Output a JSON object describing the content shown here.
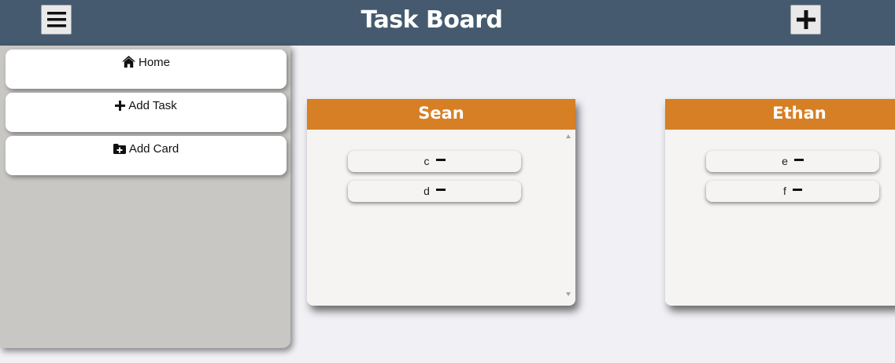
{
  "header": {
    "title": "Task Board",
    "menu_icon": "hamburger-menu-icon",
    "add_icon": "plus-icon",
    "bar_color": "#455a6e"
  },
  "sidemenu": {
    "items": [
      {
        "label": "Home",
        "icon": "home-icon"
      },
      {
        "label": "Add Task",
        "icon": "plus-icon"
      },
      {
        "label": "Add Card",
        "icon": "folder-plus-icon"
      }
    ]
  },
  "cards": [
    {
      "title": "Sean",
      "tasks": [
        "c",
        "d"
      ]
    },
    {
      "title": "Ethan",
      "tasks": [
        "e",
        "f"
      ]
    }
  ],
  "colors": {
    "card_header": "#d67f24",
    "background": "#f1f0f5",
    "sidemenu": "#c9c7c4"
  }
}
